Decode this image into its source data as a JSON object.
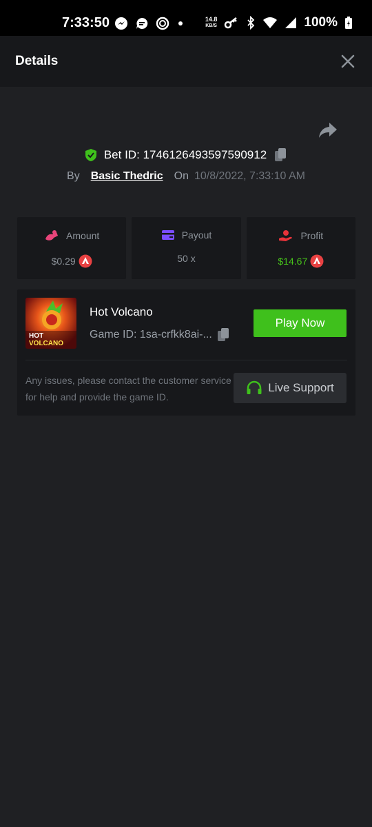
{
  "status_bar": {
    "time": "7:33:50",
    "net_speed_value": "14.8",
    "net_speed_unit": "KB/S",
    "battery": "100%"
  },
  "header": {
    "title": "Details"
  },
  "bet": {
    "id_label": "Bet ID:",
    "id_value": "1746126493597590912",
    "by_label": "By",
    "user": "Basic Thedric",
    "on_label": "On",
    "date": "10/8/2022, 7:33:10 AM"
  },
  "stats": {
    "amount_label": "Amount",
    "amount_value": "$0.29",
    "payout_label": "Payout",
    "payout_value": "50 x",
    "profit_label": "Profit",
    "profit_value": "$14.67"
  },
  "game": {
    "name": "Hot Volcano",
    "id_text": "Game ID: 1sa-crfkk8ai-...",
    "play_label": "Play Now",
    "issue_text": "Any issues, please contact the customer service for help and provide the game ID.",
    "support_label": "Live Support",
    "thumb_line1": "HOT",
    "thumb_line2": "VOLCANO"
  },
  "colors": {
    "accent_green": "#3fc01c",
    "profit_green": "#47c41a",
    "coin_red": "#e84142",
    "amount_icon_pink": "#e8447a",
    "payout_icon_purple": "#7b4dff",
    "profit_icon_red": "#e8333a"
  }
}
